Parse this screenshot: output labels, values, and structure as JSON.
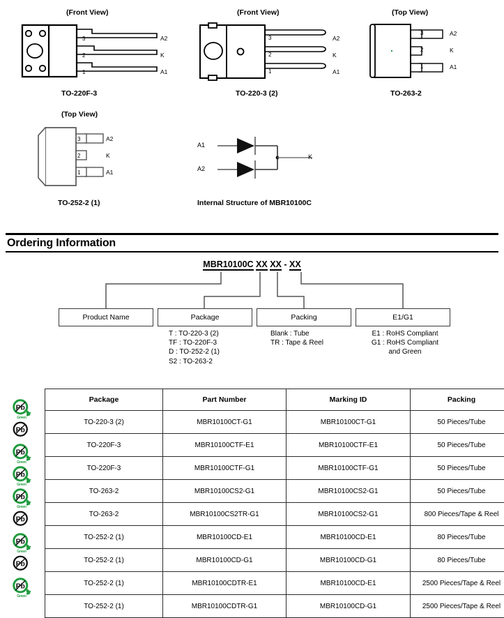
{
  "packages": [
    {
      "id": "to-220f-3",
      "view_label": "(Front View)",
      "caption": "TO-220F-3",
      "pins": [
        {
          "num": "3",
          "label": "A2"
        },
        {
          "num": "2",
          "label": "K"
        },
        {
          "num": "1",
          "label": "A1"
        }
      ]
    },
    {
      "id": "to-220-3-2",
      "view_label": "(Front View)",
      "caption": "TO-220-3 (2)",
      "pins": [
        {
          "num": "3",
          "label": "A2"
        },
        {
          "num": "2",
          "label": "K"
        },
        {
          "num": "1",
          "label": "A1"
        }
      ]
    },
    {
      "id": "to-263-2",
      "view_label": "(Top View)",
      "caption": "TO-263-2",
      "pins": [
        {
          "num": "3",
          "label": "A2"
        },
        {
          "num": "2",
          "label": "K"
        },
        {
          "num": "1",
          "label": "A1"
        }
      ]
    },
    {
      "id": "to-252-2-1",
      "view_label": "(Top View)",
      "caption": "TO-252-2 (1)",
      "pins": [
        {
          "num": "3",
          "label": "A2"
        },
        {
          "num": "2",
          "label": "K"
        },
        {
          "num": "1",
          "label": "A1"
        }
      ]
    }
  ],
  "internal_structure": {
    "caption": "Internal Structure of MBR10100C",
    "anode1": "A1",
    "anode2": "A2",
    "cathode": "K"
  },
  "ordering": {
    "section_title": "Ordering Information",
    "code": {
      "base": "MBR10100C",
      "field2": "XX",
      "field3": "XX",
      "dash": " - ",
      "field4": "XX"
    },
    "boxes": [
      {
        "id": "product-name",
        "label": "Product Name",
        "legend": ""
      },
      {
        "id": "package",
        "label": "Package",
        "legend": "T : TO-220-3 (2)\nTF : TO-220F-3\nD : TO-252-2 (1)\nS2 : TO-263-2"
      },
      {
        "id": "packing",
        "label": "Packing",
        "legend": "Blank : Tube\nTR : Tape & Reel"
      },
      {
        "id": "e1-g1",
        "label": "E1/G1",
        "legend": "E1 : RoHS Compliant\nG1 : RoHS Compliant\nand Green"
      }
    ]
  },
  "table": {
    "headers": [
      "Package",
      "Part Number",
      "Marking ID",
      "Packing"
    ],
    "rows": [
      {
        "pb": "green",
        "pb_text": "Green",
        "package": "TO-220-3 (2)",
        "part_number": "MBR10100CT-G1",
        "marking_id": "MBR10100CT-G1",
        "packing": "50 Pieces/Tube"
      },
      {
        "pb": "mono",
        "pb_text": "",
        "package": "TO-220F-3",
        "part_number": "MBR10100CTF-E1",
        "marking_id": "MBR10100CTF-E1",
        "packing": "50 Pieces/Tube"
      },
      {
        "pb": "green",
        "pb_text": "Green",
        "package": "TO-220F-3",
        "part_number": "MBR10100CTF-G1",
        "marking_id": "MBR10100CTF-G1",
        "packing": "50 Pieces/Tube"
      },
      {
        "pb": "green",
        "pb_text": "Green",
        "package": "TO-263-2",
        "part_number": "MBR10100CS2-G1",
        "marking_id": "MBR10100CS2-G1",
        "packing": "50 Pieces/Tube"
      },
      {
        "pb": "green",
        "pb_text": "Green",
        "package": "TO-263-2",
        "part_number": "MBR10100CS2TR-G1",
        "marking_id": "MBR10100CS2-G1",
        "packing": "800 Pieces/Tape & Reel"
      },
      {
        "pb": "mono",
        "pb_text": "",
        "package": "TO-252-2 (1)",
        "part_number": "MBR10100CD-E1",
        "marking_id": "MBR10100CD-E1",
        "packing": "80 Pieces/Tube"
      },
      {
        "pb": "green",
        "pb_text": "Green",
        "package": "TO-252-2 (1)",
        "part_number": "MBR10100CD-G1",
        "marking_id": "MBR10100CD-G1",
        "packing": "80 Pieces/Tube"
      },
      {
        "pb": "mono",
        "pb_text": "",
        "package": "TO-252-2  (1)",
        "part_number": "MBR10100CDTR-E1",
        "marking_id": "MBR10100CD-E1",
        "packing": "2500 Pieces/Tape & Reel"
      },
      {
        "pb": "green",
        "pb_text": "Green",
        "package": "TO-252-2  (1)",
        "part_number": "MBR10100CDTR-G1",
        "marking_id": "MBR10100CD-G1",
        "packing": "2500 Pieces/Tape & Reel"
      }
    ]
  },
  "colors": {
    "green": "#1f9b3e",
    "line": "#000000",
    "table_border": "#2b2b2b"
  },
  "icons": {
    "pb_green": "pb-free-green-icon",
    "pb_mono": "pb-free-mono-icon"
  }
}
